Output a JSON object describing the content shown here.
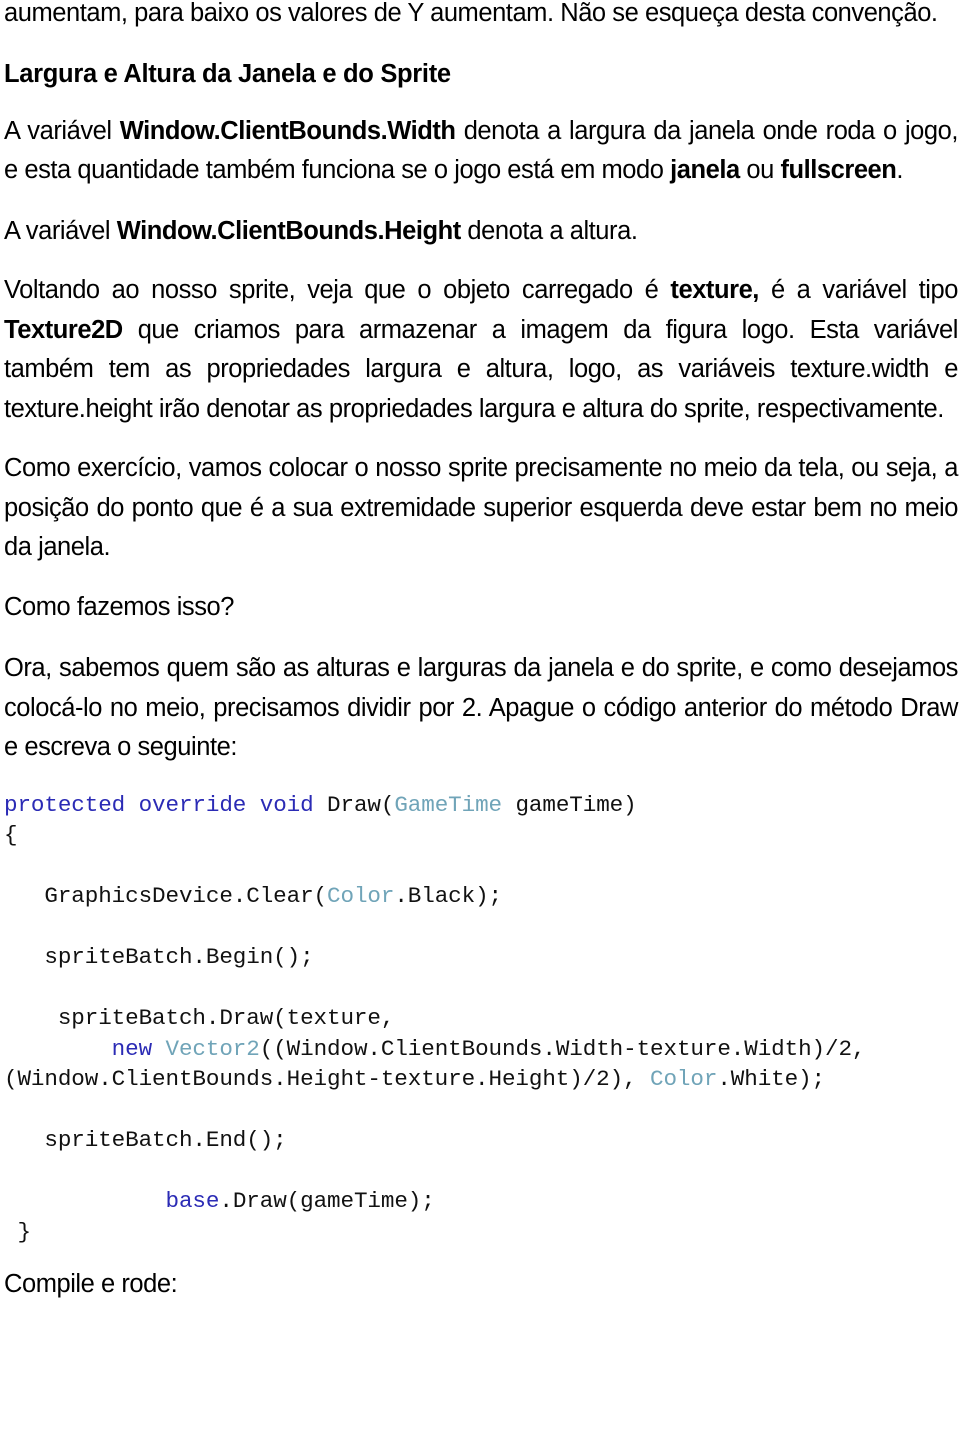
{
  "document": {
    "language": "pt-BR",
    "topic": "XNA sprite positioning tutorial"
  },
  "paragraphs": {
    "intro_line1": "aumentam, para baixo os valores de Y aumentam. Não se esqueça desta",
    "intro_line2": "convenção.",
    "heading_largura_altura": "Largura e Altura da Janela e do Sprite",
    "width_para_1": "A variável ",
    "width_para_bold_1": "Window.ClientBounds.Width",
    "width_para_2": " denota a largura da janela onde roda o jogo, e esta quantidade também funciona se o jogo está em modo ",
    "width_para_bold_2": "janela",
    "width_para_3": " ou ",
    "width_para_bold_3": "fullscreen",
    "width_para_4": ".",
    "height_para_1": "A variável ",
    "height_para_bold_1": "Window.ClientBounds.Height",
    "height_para_2": " denota a altura.",
    "texture_para_1": "Voltando ao nosso sprite, veja que o objeto carregado é ",
    "texture_para_bold_1": "texture,",
    "texture_para_2": " é a variável tipo ",
    "texture_para_bold_2": "Texture2D",
    "texture_para_3": " que criamos para armazenar a imagem da figura logo. Esta variável também tem as propriedades largura e altura, logo, as variáveis texture.width e texture.height irão denotar as propriedades largura e altura do sprite, respectivamente.",
    "exercicio_para": "Como exercício, vamos colocar o nosso sprite precisamente no meio da tela, ou seja, a posição do ponto que é a sua extremidade superior esquerda deve estar bem no meio da janela.",
    "como_fazemos": "Como fazemos isso?",
    "ora_para": "Ora, sabemos quem são as alturas e larguras da janela e do sprite, e como desejamos colocá-lo no meio, precisamos dividir por 2. Apague o código anterior do método Draw e escreva o seguinte:",
    "compile_e_rode": "Compile e rode:"
  },
  "code_block": {
    "colors": {
      "keyword": "#2b2bb5",
      "type": "#70a4b8",
      "plain": "#111111"
    },
    "line1_kw_protected": "protected",
    "line1_kw_override": " override",
    "line1_kw_void": " void",
    "line1_plain_draw": " Draw(",
    "line1_type_gametime": "GameTime",
    "line1_plain_arg": " gameTime)",
    "line2_brace_open": "{",
    "line3_plain_a": "   GraphicsDevice.Clear(",
    "line3_type_color": "Color",
    "line3_plain_b": ".Black);",
    "line4_spritebatch_begin": "   spriteBatch.Begin();",
    "line5_draw_open": "    spriteBatch.Draw(texture,",
    "line6_kw_new": "        new ",
    "line6_type_vector2": "Vector2",
    "line6_plain_rest": "((Window.ClientBounds.Width-texture.Width)/2,(Window.ClientBounds.Height-texture.Height)/2), ",
    "line6_type_color": "Color",
    "line6_plain_end": ".White);",
    "line7_spritebatch_end": "   spriteBatch.End();",
    "line8_kw_base": "            base",
    "line8_plain": ".Draw(gameTime);",
    "line9_brace_close": " }"
  }
}
